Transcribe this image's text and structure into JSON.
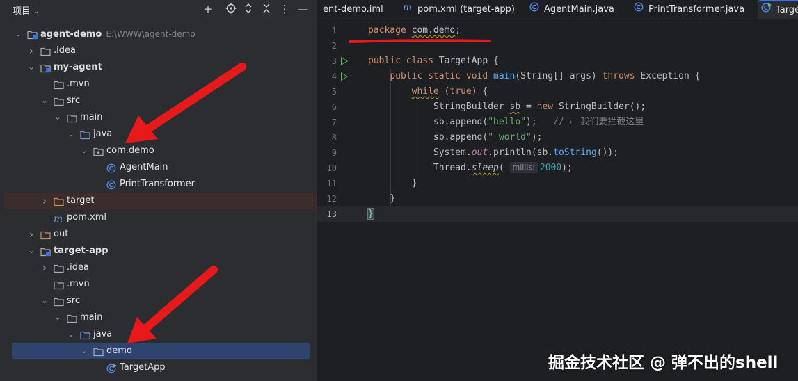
{
  "project_panel": {
    "title": "项目",
    "header_icons": [
      "add-icon",
      "locate-icon",
      "expand-all-icon",
      "collapse-all-icon",
      "more-icon",
      "minimize-icon"
    ],
    "tree": [
      {
        "label": "agent-demo",
        "path": "E:\\WWW\\agent-demo",
        "depth": 0,
        "expanded": true,
        "icon": "module-folder-icon",
        "bold": true
      },
      {
        "label": ".idea",
        "depth": 1,
        "expanded": false,
        "icon": "folder-icon"
      },
      {
        "label": "my-agent",
        "depth": 1,
        "expanded": true,
        "icon": "module-folder-icon",
        "bold": true
      },
      {
        "label": ".mvn",
        "depth": 2,
        "leaf_folder": true,
        "icon": "folder-icon"
      },
      {
        "label": "src",
        "depth": 2,
        "expanded": true,
        "icon": "folder-icon"
      },
      {
        "label": "main",
        "depth": 3,
        "expanded": true,
        "icon": "folder-icon"
      },
      {
        "label": "java",
        "depth": 4,
        "expanded": true,
        "icon": "source-folder-icon"
      },
      {
        "label": "com.demo",
        "depth": 5,
        "expanded": true,
        "icon": "package-icon"
      },
      {
        "label": "AgentMain",
        "depth": 6,
        "icon": "java-class-icon"
      },
      {
        "label": "PrintTransformer",
        "depth": 6,
        "icon": "java-class-icon"
      },
      {
        "label": "target",
        "depth": 2,
        "expanded": false,
        "icon": "excluded-folder-icon",
        "highlight": true
      },
      {
        "label": "pom.xml",
        "depth": 2,
        "icon": "maven-icon"
      },
      {
        "label": "out",
        "depth": 1,
        "expanded": false,
        "icon": "excluded-folder-icon"
      },
      {
        "label": "target-app",
        "depth": 1,
        "expanded": true,
        "icon": "module-folder-icon",
        "bold": true
      },
      {
        "label": ".idea",
        "depth": 2,
        "expanded": false,
        "icon": "folder-icon"
      },
      {
        "label": ".mvn",
        "depth": 2,
        "leaf_folder": true,
        "icon": "folder-icon"
      },
      {
        "label": "src",
        "depth": 2,
        "expanded": true,
        "icon": "folder-icon"
      },
      {
        "label": "main",
        "depth": 3,
        "expanded": true,
        "icon": "folder-icon"
      },
      {
        "label": "java",
        "depth": 4,
        "expanded": true,
        "icon": "source-folder-icon"
      },
      {
        "label": "demo",
        "depth": 5,
        "expanded": true,
        "icon": "folder-icon",
        "selected": true
      },
      {
        "label": "TargetApp",
        "depth": 6,
        "icon": "java-class-run-icon"
      }
    ]
  },
  "editor": {
    "tabs": [
      {
        "label": "ent-demo.iml",
        "icon": ""
      },
      {
        "label": "pom.xml (target-app)",
        "icon": "maven-icon"
      },
      {
        "label": "AgentMain.java",
        "icon": "java-class-icon"
      },
      {
        "label": "PrintTransformer.java",
        "icon": "java-class-icon"
      },
      {
        "label": "Targe",
        "icon": "java-class-run-icon",
        "active": true
      }
    ],
    "line_numbers": [
      "1",
      "2",
      "3",
      "4",
      "5",
      "6",
      "7",
      "8",
      "9",
      "10",
      "11",
      "12",
      "13"
    ],
    "current_line": "13",
    "code": {
      "l1_kw": "package",
      "l1_pkg": "com.demo",
      "l1_end": ";",
      "l3_kw": "public class",
      "l3_name": "TargetApp",
      "l3_end": " {",
      "l4_kw": "public static void",
      "l4_fn": "main",
      "l4_params": "(String[] args)",
      "l4_throws": "throws",
      "l4_exc": " Exception {",
      "l5_kw": "while",
      "l5_rest1": " (",
      "l5_true": "true",
      "l5_rest2": ") {",
      "l6_a": "StringBuilder ",
      "l6_var": "sb",
      "l6_b": " = ",
      "l6_new": "new",
      "l6_c": " StringBuilder();",
      "l7_a": "sb.append(",
      "l7_str": "\"hello\"",
      "l7_b": ");   ",
      "l7_cm": "// ← 我们要拦截这里",
      "l8_a": "sb.append(",
      "l8_str": "\" world\"",
      "l8_b": ");",
      "l9_a": "System.",
      "l9_out": "out",
      "l9_b": ".println(sb.",
      "l9_fn": "toString",
      "l9_c": "());",
      "l10_a": "Thread.",
      "l10_fn": "sleep",
      "l10_b": "( ",
      "l10_hint": "millis:",
      "l10_num": "2000",
      "l10_c": ");",
      "l11": "}",
      "l12": "}",
      "l13": "}"
    },
    "run_gutter_lines": [
      "3",
      "4"
    ]
  },
  "watermark": "掘金技术社区 @ 弹不出的shell",
  "annotation_color": "#e8191a"
}
